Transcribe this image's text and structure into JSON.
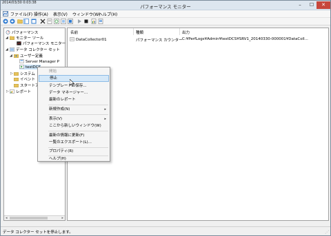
{
  "titlebar": {
    "timestamp": "2014/03/30 0:03:38",
    "title": "パフォーマンス モニター",
    "min": "–",
    "max": "☐",
    "close": "✕"
  },
  "menu": {
    "items": [
      "ファイル(F)",
      "操作(A)",
      "表示(V)",
      "ウィンドウ(W)",
      "ヘルプ(H)"
    ]
  },
  "tree": {
    "items": [
      {
        "label": "パフォーマンス"
      },
      {
        "label": "モニター ツール"
      },
      {
        "label": "パフォーマンス モニター"
      },
      {
        "label": "データ コレクター セット"
      },
      {
        "label": "ユーザー定義"
      },
      {
        "label": "Server Manager P"
      },
      {
        "label": "testDCS"
      },
      {
        "label": "システム"
      },
      {
        "label": "イベント"
      },
      {
        "label": "スタートア"
      },
      {
        "label": "レポート"
      }
    ]
  },
  "list": {
    "columns": [
      "名前",
      "種類",
      "出力"
    ],
    "rows": [
      {
        "name": "DataCollector01",
        "type": "パフォーマンス カウンター",
        "output": "C:¥PerfLogs¥Admin¥testDCS¥SRV1_20140330-000001¥DataColl..."
      }
    ]
  },
  "context_menu": {
    "items": [
      {
        "label": "開始",
        "state": "disabled"
      },
      {
        "label": "停止",
        "state": "hover"
      },
      {
        "label": "テンプレートの保存..."
      },
      {
        "label": "データ マネージャー..."
      },
      {
        "label": "最新のレポート"
      },
      {
        "label": "新規作成(N)",
        "submenu": true
      },
      {
        "label": "表示(V)",
        "submenu": true
      },
      {
        "label": "ここから新しいウィンドウ(W)"
      },
      {
        "label": "最新の情報に更新(F)"
      },
      {
        "label": "一覧のエクスポート(L)..."
      },
      {
        "label": "プロパティ(R)"
      },
      {
        "label": "ヘルプ(H)"
      }
    ]
  },
  "status": {
    "text": "データ コレクター セットを停止します。"
  },
  "colors": {
    "hover_bg": "#d5e8f8",
    "close_red": "#c7463b",
    "titlebar": "#dde6ef"
  }
}
